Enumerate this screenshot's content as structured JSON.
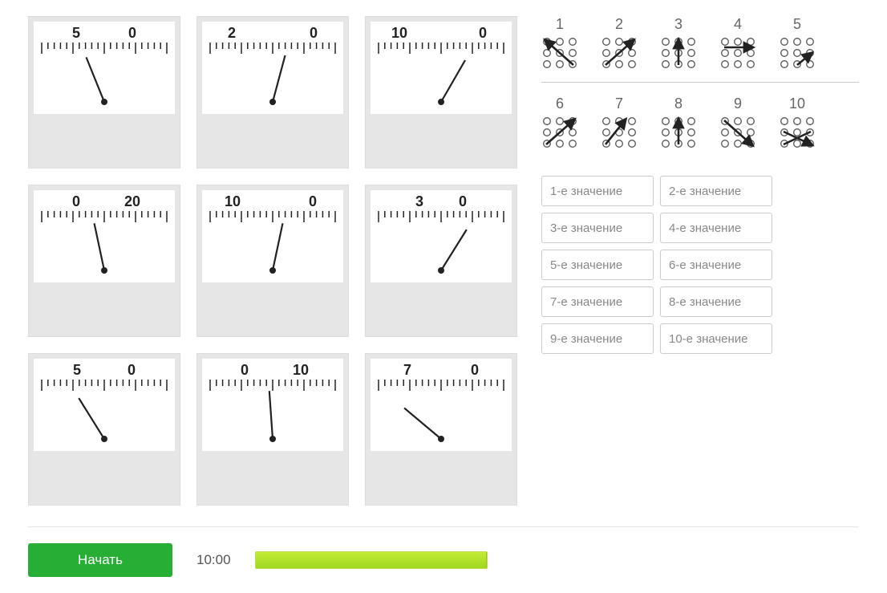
{
  "gauges": [
    {
      "label_left": "5",
      "label_right": "0",
      "lo": 30,
      "ro": 0,
      "angle": -22
    },
    {
      "label_left": "2",
      "label_right": "0",
      "lo": 62,
      "ro": 0,
      "angle": 15
    },
    {
      "label_left": "10",
      "label_right": "0",
      "lo": 64,
      "ro": 0,
      "angle": 30
    },
    {
      "label_left": "0",
      "label_right": "20",
      "lo": 0,
      "ro": 30,
      "angle": -12
    },
    {
      "label_left": "10",
      "label_right": "0",
      "lo": 60,
      "ro": 0,
      "angle": 12
    },
    {
      "label_left": "3",
      "label_right": "0",
      "lo": 14,
      "ro": 0,
      "angle": 32
    },
    {
      "label_left": "5",
      "label_right": "0",
      "lo": 28,
      "ro": 0,
      "angle": -32
    },
    {
      "label_left": "0",
      "label_right": "10",
      "lo": 0,
      "ro": 30,
      "angle": -4
    },
    {
      "label_left": "7",
      "label_right": "0",
      "lo": 44,
      "ro": 0,
      "angle": -50
    }
  ],
  "key": {
    "row1": [
      "1",
      "2",
      "3",
      "4",
      "5"
    ],
    "row2": [
      "6",
      "7",
      "8",
      "9",
      "10"
    ]
  },
  "input_placeholders": [
    "1-е значение",
    "2-е значение",
    "3-е значение",
    "4-е значение",
    "5-е значение",
    "6-е значение",
    "7-е значение",
    "8-е значение",
    "9-е значение",
    "10-е значение"
  ],
  "buttons": {
    "start": "Начать"
  },
  "timer": {
    "display": "10:00",
    "progress_pct": 100
  }
}
